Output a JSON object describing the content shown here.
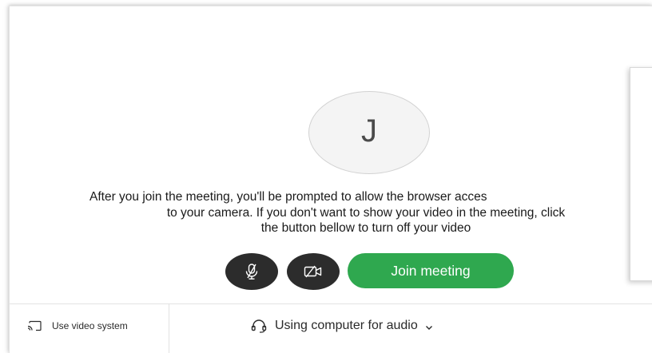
{
  "avatar": {
    "initial": "J"
  },
  "message": {
    "line1": "After you join the meeting, you'll be prompted to allow the browser acces",
    "line2": "to your camera. If you don't want to show your video in the meeting, click",
    "line3": "the button bellow to turn off your video"
  },
  "controls": {
    "mute_icon": "microphone-muted-icon",
    "video_icon": "video-camera-off-icon",
    "join_label": "Join meeting"
  },
  "footer": {
    "video_system_icon": "cast-screen-icon",
    "video_system_label": "Use video system",
    "audio_icon": "headset-icon",
    "audio_label": "Using computer for audio",
    "audio_chevron_icon": "chevron-down-icon"
  },
  "colors": {
    "join_button": "#2fa84f",
    "control_button": "#2c2c2c",
    "avatar_bg": "#f4f4f4"
  }
}
